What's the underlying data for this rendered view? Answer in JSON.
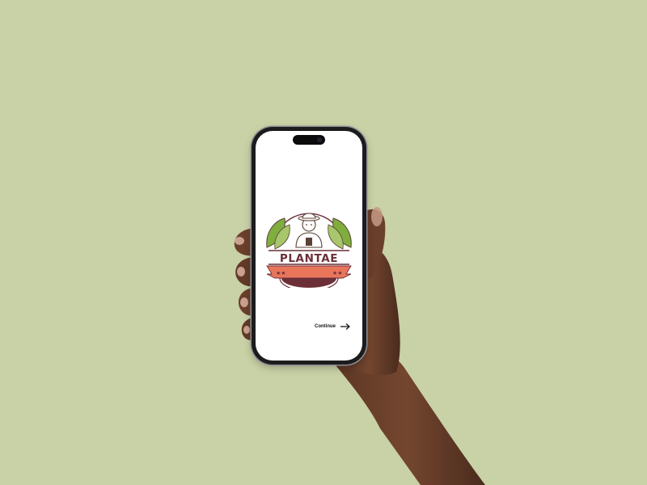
{
  "app": {
    "brand_name": "PLANTAE",
    "continue_label": "Continue"
  },
  "icons": {
    "logo": "gardener-emblem-icon",
    "continue": "arrow-right-icon"
  },
  "colors": {
    "background": "#c9d1a6",
    "brand_maroon": "#6b2f37",
    "banner_orange": "#e9765b",
    "leaf_green": "#7fae3f"
  }
}
